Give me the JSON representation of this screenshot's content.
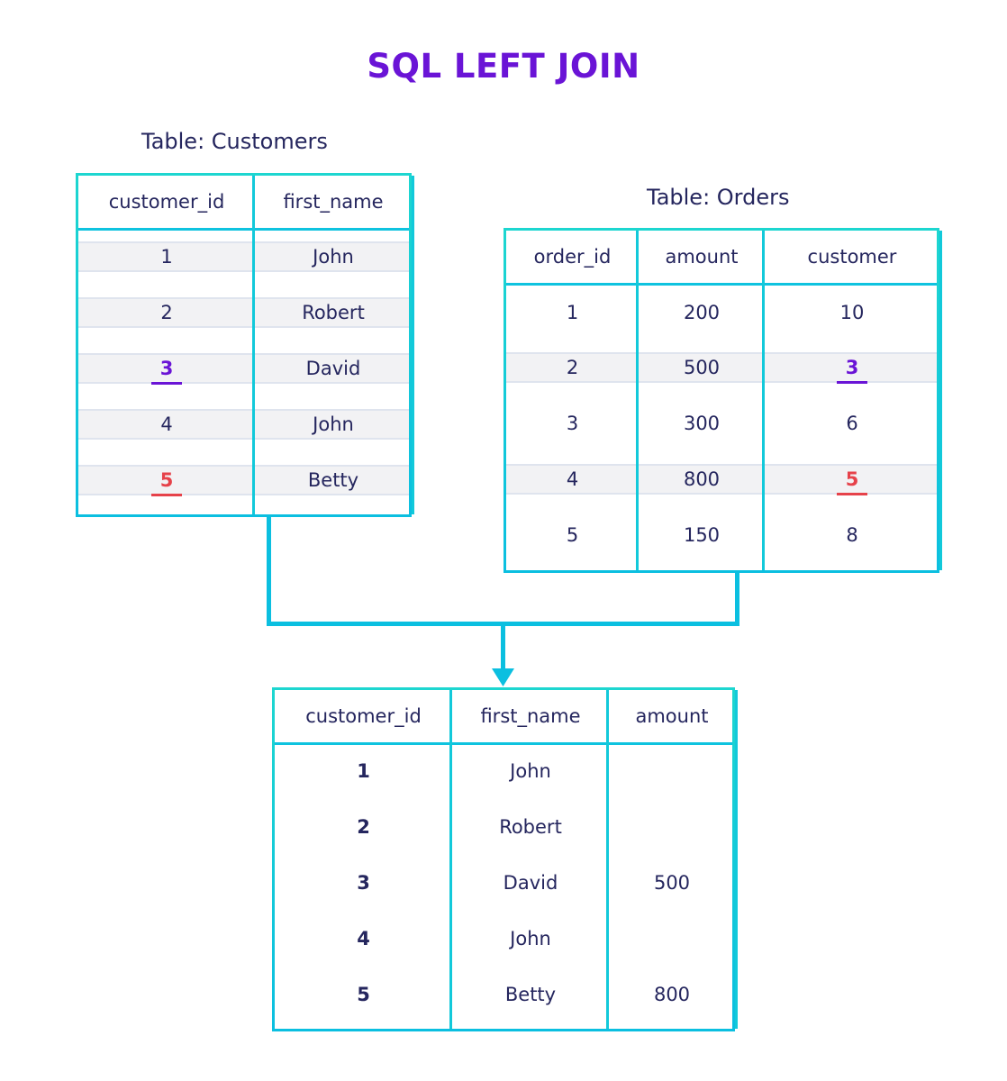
{
  "title": "SQL LEFT JOIN",
  "colors": {
    "title": "#6a14d6",
    "border": "#12c9da",
    "text": "#25265e",
    "match_purple": "#6a14d6",
    "match_red": "#e6424a",
    "stripe": "#f2f2f4"
  },
  "customers": {
    "caption": "Table: Customers",
    "headers": [
      "customer_id",
      "first_name"
    ],
    "rows": [
      [
        "1",
        "John"
      ],
      [
        "2",
        "Robert"
      ],
      [
        "3",
        "David"
      ],
      [
        "4",
        "John"
      ],
      [
        "5",
        "Betty"
      ]
    ],
    "highlighted": [
      {
        "row": 2,
        "col": 0,
        "color": "purple"
      },
      {
        "row": 4,
        "col": 0,
        "color": "red"
      }
    ]
  },
  "orders": {
    "caption": "Table: Orders",
    "headers": [
      "order_id",
      "amount",
      "customer"
    ],
    "rows": [
      [
        "1",
        "200",
        "10"
      ],
      [
        "2",
        "500",
        "3"
      ],
      [
        "3",
        "300",
        "6"
      ],
      [
        "4",
        "800",
        "5"
      ],
      [
        "5",
        "150",
        "8"
      ]
    ],
    "highlighted": [
      {
        "row": 1,
        "col": 2,
        "color": "purple"
      },
      {
        "row": 3,
        "col": 2,
        "color": "red"
      }
    ]
  },
  "result": {
    "headers": [
      "customer_id",
      "first_name",
      "amount"
    ],
    "rows": [
      [
        "1",
        "John",
        ""
      ],
      [
        "2",
        "Robert",
        ""
      ],
      [
        "3",
        "David",
        "500"
      ],
      [
        "4",
        "John",
        ""
      ],
      [
        "5",
        "Betty",
        "800"
      ]
    ]
  }
}
